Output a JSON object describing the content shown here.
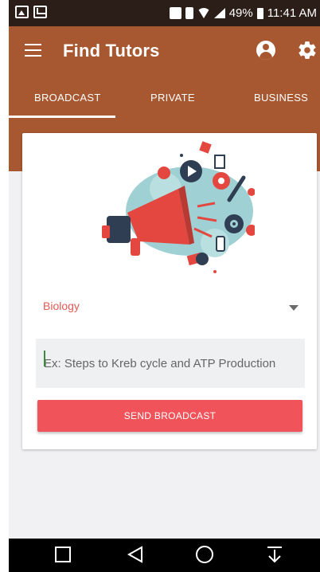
{
  "status_bar": {
    "battery": "49%",
    "time": "11:41 AM"
  },
  "app_bar": {
    "title": "Find Tutors",
    "icons": [
      "menu-icon",
      "account-icon",
      "gear-icon"
    ]
  },
  "tabs": [
    {
      "label": "BROADCAST",
      "selected": true
    },
    {
      "label": "PRIVATE",
      "selected": false
    },
    {
      "label": "BUSINESS",
      "selected": false
    }
  ],
  "form": {
    "subject": "Biology",
    "question_placeholder": "Ex: Steps to Kreb cycle and ATP Production",
    "question_value": "",
    "submit_label": "SEND BROADCAST"
  },
  "nav_bar": {
    "icons": [
      "recent-apps-icon",
      "back-icon",
      "home-icon",
      "download-icon"
    ]
  },
  "colors": {
    "primary": "#a85831",
    "accent": "#f1535a",
    "subject_text": "#e05b55",
    "status_bar": "#2b1d17"
  }
}
